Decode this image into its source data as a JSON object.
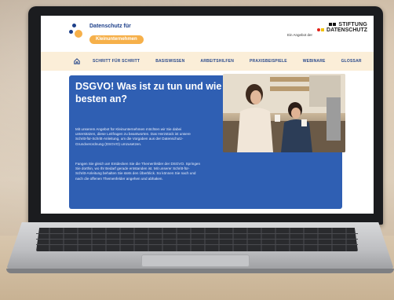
{
  "site": {
    "logo_line1": "Datenschutz für",
    "logo_pill": "Kleinunternehmen",
    "sponsor_tag": "Ein Angebot der",
    "sponsor_line1": "STIFTUNG",
    "sponsor_line2": "DATENSCHUTZ"
  },
  "nav": {
    "items": [
      {
        "label": "SCHRITT FÜR SCHRITT"
      },
      {
        "label": "BASISWISSEN"
      },
      {
        "label": "ARBEITSHILFEN"
      },
      {
        "label": "PRAXISBEISPIELE"
      },
      {
        "label": "WEBINARE"
      },
      {
        "label": "GLOSSAR"
      }
    ]
  },
  "hero": {
    "title": "DSGVO! Was ist zu tun und wie gehen Sie es am besten an?",
    "paragraph1": "Mit unserem Angebot für Kleinunternehmen möchten wir Sie dabei unterstützen, diese Leitfragen zu beantworten. Das Herzstück ist unsere Schritt-für-Schritt-Anleitung, um die Vorgaben aus der Datenschutz-Grundverordnung (DSGVO) umzusetzen.",
    "paragraph2": "Fangen Sie gleich an! Entdecken Sie die Themenfelder der DSGVO. Springen Sie dorthin, wo Ihr Bedarf gerade entstanden ist. Mit unserer Schritt-für-Schritt-Anleitung behalten Sie stets den Überblick. So können Sie nach und nach die offenen Themenfelder angehen und abhaken."
  },
  "colors": {
    "brand_blue": "#2f5fb3",
    "accent_orange": "#f6b04a",
    "nav_bg": "#fbeed8"
  },
  "icons": {
    "home": "home-icon"
  }
}
